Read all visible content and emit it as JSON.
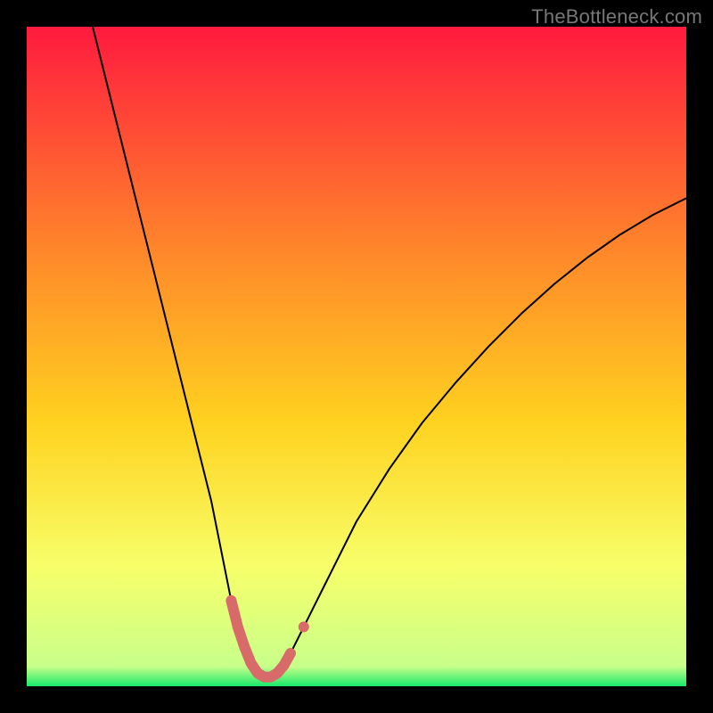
{
  "watermark": "TheBottleneck.com",
  "chart_data": {
    "type": "line",
    "title": "",
    "xlabel": "",
    "ylabel": "",
    "xlim": [
      0,
      100
    ],
    "ylim": [
      0,
      100
    ],
    "background_gradient": {
      "top": "#ff1a3e",
      "mid1": "#ff6a2a",
      "mid2": "#ffd21f",
      "mid3": "#f7ff6a",
      "bottom": "#17e86a"
    },
    "series": [
      {
        "name": "bottleneck-curve",
        "stroke": "#000000",
        "stroke_width": 2,
        "x": [
          10,
          12,
          14,
          16,
          18,
          20,
          22,
          24,
          26,
          28,
          30,
          31,
          32,
          33,
          34,
          35,
          36,
          37,
          38,
          39,
          40,
          42,
          45,
          50,
          55,
          60,
          65,
          70,
          75,
          80,
          85,
          90,
          95,
          100
        ],
        "values": [
          100,
          92,
          84,
          76,
          68,
          60,
          52,
          44,
          36,
          28,
          18,
          13,
          9,
          6,
          3.5,
          2,
          1.4,
          1.4,
          2,
          3.2,
          5,
          9,
          15,
          25,
          33,
          40,
          46,
          51.5,
          56.5,
          61,
          65,
          68.5,
          71.5,
          74
        ]
      },
      {
        "name": "highlight-minimum",
        "stroke": "#d86a6a",
        "stroke_width": 12,
        "linecap": "round",
        "x": [
          31,
          32,
          33,
          34,
          35,
          36,
          37,
          38,
          39,
          40
        ],
        "values": [
          13,
          9,
          6,
          3.5,
          2,
          1.4,
          1.4,
          2,
          3.2,
          5
        ]
      },
      {
        "name": "highlight-dot",
        "type": "scatter",
        "fill": "#d86a6a",
        "radius": 6,
        "x": [
          42
        ],
        "values": [
          9
        ]
      }
    ]
  }
}
